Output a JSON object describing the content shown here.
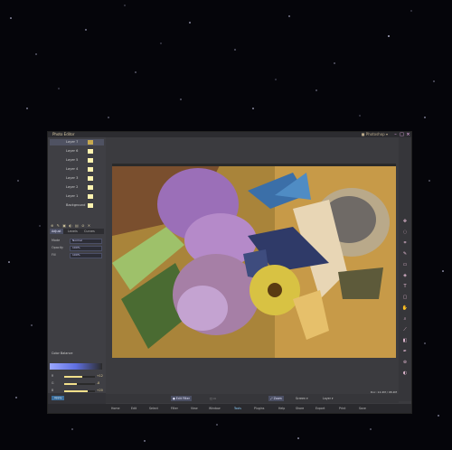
{
  "window": {
    "title": "Photo Editor",
    "right_text": "■ Photoshop ▾",
    "buttons": {
      "min": "–",
      "max": "□",
      "close": "×"
    }
  },
  "layers": [
    {
      "label": "Layer 7",
      "selected": true
    },
    {
      "label": "Layer 6",
      "selected": false
    },
    {
      "label": "Layer 5",
      "selected": false
    },
    {
      "label": "Layer 4",
      "selected": false
    },
    {
      "label": "Layer 3",
      "selected": false
    },
    {
      "label": "Layer 2",
      "selected": false
    },
    {
      "label": "Layer 1",
      "selected": false
    },
    {
      "label": "Background",
      "selected": false
    }
  ],
  "layer_toolbar_icons": "⊕ ✎ ▣ ◐ ▤ ⊘ ✕",
  "panel_tabs": [
    "Adjust",
    "Levels",
    "Curves"
  ],
  "panel": {
    "fields": [
      {
        "label": "Mode",
        "value": "Normal"
      },
      {
        "label": "Opacity",
        "value": "100%"
      },
      {
        "label": "Fill",
        "value": "100%"
      }
    ],
    "color_title": "Color Balance",
    "sliders": [
      {
        "label": "R",
        "value": 0.6,
        "display": "+12"
      },
      {
        "label": "G",
        "value": 0.4,
        "display": "-8"
      },
      {
        "label": "B",
        "value": 0.75,
        "display": "+20"
      }
    ]
  },
  "bottom_left": {
    "button_label": "Apply"
  },
  "status": {
    "items": [
      "● Edit Filter",
      "▢ ▭",
      "⤢ Zoom",
      "Screen ▾",
      "Layer ▾"
    ],
    "right_info": "Doc: 12.4M / 48.2M"
  },
  "bottom_bar": [
    "Home",
    "Edit",
    "Select",
    "Filter",
    "View",
    "Window",
    "Tools",
    "Plugins",
    "Help",
    "Share",
    "Export",
    "Print",
    "Save"
  ],
  "canvas_description": "painting of flowers and butterflies",
  "colors": {
    "panel": "#3f3f44",
    "accent": "#4a4e62",
    "highlight": "#f1df8a"
  }
}
